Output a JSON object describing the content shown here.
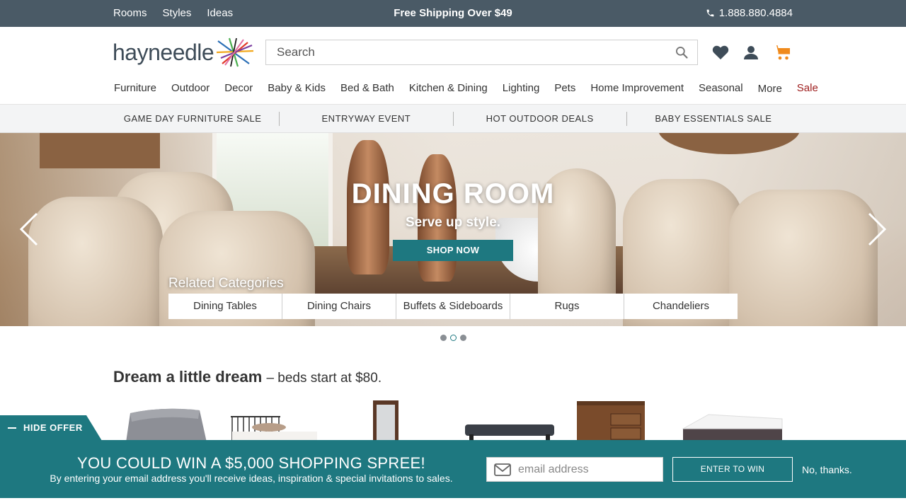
{
  "topbar": {
    "links": [
      "Rooms",
      "Styles",
      "Ideas"
    ],
    "promo": "Free Shipping Over $49",
    "phone": "1.888.880.4884"
  },
  "header": {
    "logo_text": "hayneedle",
    "search_placeholder": "Search"
  },
  "nav": {
    "items": [
      "Furniture",
      "Outdoor",
      "Decor",
      "Baby & Kids",
      "Bed & Bath",
      "Kitchen & Dining",
      "Lighting",
      "Pets",
      "Home Improvement",
      "Seasonal",
      "More",
      "Sale"
    ]
  },
  "promos": [
    "GAME DAY FURNITURE SALE",
    "ENTRYWAY EVENT",
    "HOT OUTDOOR DEALS",
    "BABY ESSENTIALS SALE"
  ],
  "hero": {
    "title": "DINING ROOM",
    "subtitle": "Serve up style.",
    "cta": "SHOP NOW",
    "related_title": "Related Categories",
    "related": [
      "Dining Tables",
      "Dining Chairs",
      "Buffets & Sideboards",
      "Rugs",
      "Chandeliers"
    ],
    "active_slide": 2,
    "slide_count": 3
  },
  "section": {
    "title": "Dream a little dream",
    "subtitle": "– beds start at $80."
  },
  "offer": {
    "hide_label": "HIDE OFFER",
    "headline": "YOU COULD WIN A $5,000 SHOPPING SPREE!",
    "subtext": "By entering your email address you'll receive ideas, inspiration & special invitations to sales.",
    "email_placeholder": "email address",
    "enter_button": "ENTER TO WIN",
    "decline": "No, thanks."
  },
  "colors": {
    "topbar": "#4a5a66",
    "accent_teal": "#1e7880",
    "sale_red": "#9d1c1c",
    "cart_orange": "#f08a1c"
  }
}
